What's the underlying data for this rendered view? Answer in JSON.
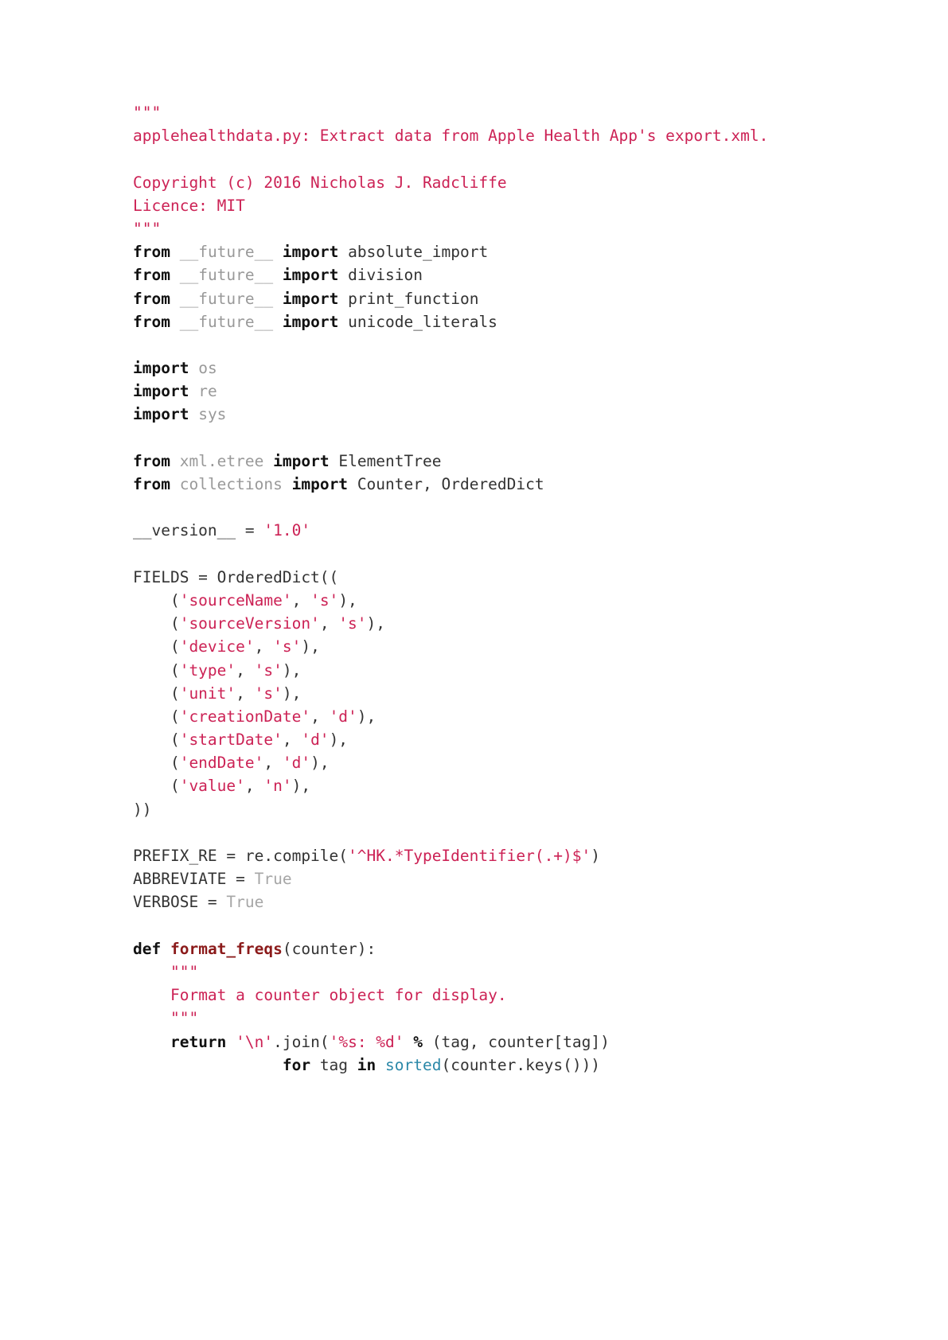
{
  "document": {
    "kind": "python-source-listing",
    "file_title": "applehealthdata.py",
    "background_color": "#ffffff",
    "token_colors": {
      "string": "#cc2255",
      "docstring": "#cc2255",
      "keyword": "#111111",
      "operator": "#111111",
      "module": "#999999",
      "constant": "#a6a6a6",
      "function_name": "#8b1a1a",
      "builtin": "#2b88a8",
      "plain": "#333333"
    }
  },
  "code": {
    "lines": [
      {
        "id": "l1",
        "text": "\"\"\"",
        "tokens": [
          {
            "t": "\"\"\"",
            "c": "tok-doc"
          }
        ]
      },
      {
        "id": "l2",
        "text": "applehealthdata.py: Extract data from Apple Health App's export.xml.",
        "tokens": [
          {
            "t": "applehealthdata.py: Extract data from Apple Health App's export.xml.",
            "c": "tok-doc"
          }
        ]
      },
      {
        "id": "l3",
        "text": "",
        "tokens": []
      },
      {
        "id": "l4",
        "text": "Copyright (c) 2016 Nicholas J. Radcliffe",
        "tokens": [
          {
            "t": "Copyright (c) 2016 Nicholas J. Radcliffe",
            "c": "tok-doc"
          }
        ]
      },
      {
        "id": "l5",
        "text": "Licence: MIT",
        "tokens": [
          {
            "t": "Licence: MIT",
            "c": "tok-doc"
          }
        ]
      },
      {
        "id": "l6",
        "text": "\"\"\"",
        "tokens": [
          {
            "t": "\"\"\"",
            "c": "tok-doc"
          }
        ]
      },
      {
        "id": "l7",
        "text": "from __future__ import absolute_import",
        "tokens": [
          {
            "t": "from",
            "c": "tok-kw"
          },
          {
            "t": " ",
            "c": "tok-plain"
          },
          {
            "t": "__future__",
            "c": "tok-mod"
          },
          {
            "t": " ",
            "c": "tok-plain"
          },
          {
            "t": "import",
            "c": "tok-kw"
          },
          {
            "t": " ",
            "c": "tok-plain"
          },
          {
            "t": "absolute_import",
            "c": "tok-name"
          }
        ]
      },
      {
        "id": "l8",
        "text": "from __future__ import division",
        "tokens": [
          {
            "t": "from",
            "c": "tok-kw"
          },
          {
            "t": " ",
            "c": "tok-plain"
          },
          {
            "t": "__future__",
            "c": "tok-mod"
          },
          {
            "t": " ",
            "c": "tok-plain"
          },
          {
            "t": "import",
            "c": "tok-kw"
          },
          {
            "t": " ",
            "c": "tok-plain"
          },
          {
            "t": "division",
            "c": "tok-name"
          }
        ]
      },
      {
        "id": "l9",
        "text": "from __future__ import print_function",
        "tokens": [
          {
            "t": "from",
            "c": "tok-kw"
          },
          {
            "t": " ",
            "c": "tok-plain"
          },
          {
            "t": "__future__",
            "c": "tok-mod"
          },
          {
            "t": " ",
            "c": "tok-plain"
          },
          {
            "t": "import",
            "c": "tok-kw"
          },
          {
            "t": " ",
            "c": "tok-plain"
          },
          {
            "t": "print_function",
            "c": "tok-name"
          }
        ]
      },
      {
        "id": "l10",
        "text": "from __future__ import unicode_literals",
        "tokens": [
          {
            "t": "from",
            "c": "tok-kw"
          },
          {
            "t": " ",
            "c": "tok-plain"
          },
          {
            "t": "__future__",
            "c": "tok-mod"
          },
          {
            "t": " ",
            "c": "tok-plain"
          },
          {
            "t": "import",
            "c": "tok-kw"
          },
          {
            "t": " ",
            "c": "tok-plain"
          },
          {
            "t": "unicode_literals",
            "c": "tok-name"
          }
        ]
      },
      {
        "id": "l11",
        "text": "",
        "tokens": []
      },
      {
        "id": "l12",
        "text": "import os",
        "tokens": [
          {
            "t": "import",
            "c": "tok-kw"
          },
          {
            "t": " ",
            "c": "tok-plain"
          },
          {
            "t": "os",
            "c": "tok-mod"
          }
        ]
      },
      {
        "id": "l13",
        "text": "import re",
        "tokens": [
          {
            "t": "import",
            "c": "tok-kw"
          },
          {
            "t": " ",
            "c": "tok-plain"
          },
          {
            "t": "re",
            "c": "tok-mod"
          }
        ]
      },
      {
        "id": "l14",
        "text": "import sys",
        "tokens": [
          {
            "t": "import",
            "c": "tok-kw"
          },
          {
            "t": " ",
            "c": "tok-plain"
          },
          {
            "t": "sys",
            "c": "tok-mod"
          }
        ]
      },
      {
        "id": "l15",
        "text": "",
        "tokens": []
      },
      {
        "id": "l16",
        "text": "from xml.etree import ElementTree",
        "tokens": [
          {
            "t": "from",
            "c": "tok-kw"
          },
          {
            "t": " ",
            "c": "tok-plain"
          },
          {
            "t": "xml.etree",
            "c": "tok-mod"
          },
          {
            "t": " ",
            "c": "tok-plain"
          },
          {
            "t": "import",
            "c": "tok-kw"
          },
          {
            "t": " ",
            "c": "tok-plain"
          },
          {
            "t": "ElementTree",
            "c": "tok-name"
          }
        ]
      },
      {
        "id": "l17",
        "text": "from collections import Counter, OrderedDict",
        "tokens": [
          {
            "t": "from",
            "c": "tok-kw"
          },
          {
            "t": " ",
            "c": "tok-plain"
          },
          {
            "t": "collections",
            "c": "tok-mod"
          },
          {
            "t": " ",
            "c": "tok-plain"
          },
          {
            "t": "import",
            "c": "tok-kw"
          },
          {
            "t": " ",
            "c": "tok-plain"
          },
          {
            "t": "Counter, OrderedDict",
            "c": "tok-name"
          }
        ]
      },
      {
        "id": "l18",
        "text": "",
        "tokens": []
      },
      {
        "id": "l19",
        "text": "__version__ = '1.0'",
        "tokens": [
          {
            "t": "__version__ = ",
            "c": "tok-plain"
          },
          {
            "t": "'1.0'",
            "c": "tok-str"
          }
        ]
      },
      {
        "id": "l20",
        "text": "",
        "tokens": []
      },
      {
        "id": "l21",
        "text": "FIELDS = OrderedDict((",
        "tokens": [
          {
            "t": "FIELDS = OrderedDict((",
            "c": "tok-plain"
          }
        ]
      },
      {
        "id": "l22",
        "text": "    ('sourceName', 's'),",
        "tokens": [
          {
            "t": "    (",
            "c": "tok-plain"
          },
          {
            "t": "'sourceName'",
            "c": "tok-str"
          },
          {
            "t": ", ",
            "c": "tok-plain"
          },
          {
            "t": "'s'",
            "c": "tok-str"
          },
          {
            "t": "),",
            "c": "tok-plain"
          }
        ]
      },
      {
        "id": "l23",
        "text": "    ('sourceVersion', 's'),",
        "tokens": [
          {
            "t": "    (",
            "c": "tok-plain"
          },
          {
            "t": "'sourceVersion'",
            "c": "tok-str"
          },
          {
            "t": ", ",
            "c": "tok-plain"
          },
          {
            "t": "'s'",
            "c": "tok-str"
          },
          {
            "t": "),",
            "c": "tok-plain"
          }
        ]
      },
      {
        "id": "l24",
        "text": "    ('device', 's'),",
        "tokens": [
          {
            "t": "    (",
            "c": "tok-plain"
          },
          {
            "t": "'device'",
            "c": "tok-str"
          },
          {
            "t": ", ",
            "c": "tok-plain"
          },
          {
            "t": "'s'",
            "c": "tok-str"
          },
          {
            "t": "),",
            "c": "tok-plain"
          }
        ]
      },
      {
        "id": "l25",
        "text": "    ('type', 's'),",
        "tokens": [
          {
            "t": "    (",
            "c": "tok-plain"
          },
          {
            "t": "'type'",
            "c": "tok-str"
          },
          {
            "t": ", ",
            "c": "tok-plain"
          },
          {
            "t": "'s'",
            "c": "tok-str"
          },
          {
            "t": "),",
            "c": "tok-plain"
          }
        ]
      },
      {
        "id": "l26",
        "text": "    ('unit', 's'),",
        "tokens": [
          {
            "t": "    (",
            "c": "tok-plain"
          },
          {
            "t": "'unit'",
            "c": "tok-str"
          },
          {
            "t": ", ",
            "c": "tok-plain"
          },
          {
            "t": "'s'",
            "c": "tok-str"
          },
          {
            "t": "),",
            "c": "tok-plain"
          }
        ]
      },
      {
        "id": "l27",
        "text": "    ('creationDate', 'd'),",
        "tokens": [
          {
            "t": "    (",
            "c": "tok-plain"
          },
          {
            "t": "'creationDate'",
            "c": "tok-str"
          },
          {
            "t": ", ",
            "c": "tok-plain"
          },
          {
            "t": "'d'",
            "c": "tok-str"
          },
          {
            "t": "),",
            "c": "tok-plain"
          }
        ]
      },
      {
        "id": "l28",
        "text": "    ('startDate', 'd'),",
        "tokens": [
          {
            "t": "    (",
            "c": "tok-plain"
          },
          {
            "t": "'startDate'",
            "c": "tok-str"
          },
          {
            "t": ", ",
            "c": "tok-plain"
          },
          {
            "t": "'d'",
            "c": "tok-str"
          },
          {
            "t": "),",
            "c": "tok-plain"
          }
        ]
      },
      {
        "id": "l29",
        "text": "    ('endDate', 'd'),",
        "tokens": [
          {
            "t": "    (",
            "c": "tok-plain"
          },
          {
            "t": "'endDate'",
            "c": "tok-str"
          },
          {
            "t": ", ",
            "c": "tok-plain"
          },
          {
            "t": "'d'",
            "c": "tok-str"
          },
          {
            "t": "),",
            "c": "tok-plain"
          }
        ]
      },
      {
        "id": "l30",
        "text": "    ('value', 'n'),",
        "tokens": [
          {
            "t": "    (",
            "c": "tok-plain"
          },
          {
            "t": "'value'",
            "c": "tok-str"
          },
          {
            "t": ", ",
            "c": "tok-plain"
          },
          {
            "t": "'n'",
            "c": "tok-str"
          },
          {
            "t": "),",
            "c": "tok-plain"
          }
        ]
      },
      {
        "id": "l31",
        "text": "))",
        "tokens": [
          {
            "t": "))",
            "c": "tok-plain"
          }
        ]
      },
      {
        "id": "l32",
        "text": "",
        "tokens": []
      },
      {
        "id": "l33",
        "text": "PREFIX_RE = re.compile('^HK.*TypeIdentifier(.+)$')",
        "tokens": [
          {
            "t": "PREFIX_RE = re.compile(",
            "c": "tok-plain"
          },
          {
            "t": "'^HK.*TypeIdentifier(.+)$'",
            "c": "tok-str"
          },
          {
            "t": ")",
            "c": "tok-plain"
          }
        ]
      },
      {
        "id": "l34",
        "text": "ABBREVIATE = True",
        "tokens": [
          {
            "t": "ABBREVIATE = ",
            "c": "tok-plain"
          },
          {
            "t": "True",
            "c": "tok-const"
          }
        ]
      },
      {
        "id": "l35",
        "text": "VERBOSE = True",
        "tokens": [
          {
            "t": "VERBOSE = ",
            "c": "tok-plain"
          },
          {
            "t": "True",
            "c": "tok-const"
          }
        ]
      },
      {
        "id": "l36",
        "text": "",
        "tokens": []
      },
      {
        "id": "l37",
        "text": "def format_freqs(counter):",
        "tokens": [
          {
            "t": "def",
            "c": "tok-kw"
          },
          {
            "t": " ",
            "c": "tok-plain"
          },
          {
            "t": "format_freqs",
            "c": "tok-func"
          },
          {
            "t": "(counter):",
            "c": "tok-plain"
          }
        ]
      },
      {
        "id": "l38",
        "text": "    \"\"\"",
        "tokens": [
          {
            "t": "    ",
            "c": "tok-plain"
          },
          {
            "t": "\"\"\"",
            "c": "tok-doc"
          }
        ]
      },
      {
        "id": "l39",
        "text": "    Format a counter object for display.",
        "tokens": [
          {
            "t": "    ",
            "c": "tok-plain"
          },
          {
            "t": "Format a counter object for display.",
            "c": "tok-doc"
          }
        ]
      },
      {
        "id": "l40",
        "text": "    \"\"\"",
        "tokens": [
          {
            "t": "    ",
            "c": "tok-plain"
          },
          {
            "t": "\"\"\"",
            "c": "tok-doc"
          }
        ]
      },
      {
        "id": "l41",
        "text": "    return '\\n'.join('%s: %d' % (tag, counter[tag])",
        "tokens": [
          {
            "t": "    ",
            "c": "tok-plain"
          },
          {
            "t": "return",
            "c": "tok-kw"
          },
          {
            "t": " ",
            "c": "tok-plain"
          },
          {
            "t": "'\\n'",
            "c": "tok-str"
          },
          {
            "t": ".join(",
            "c": "tok-plain"
          },
          {
            "t": "'%s: %d'",
            "c": "tok-str"
          },
          {
            "t": " ",
            "c": "tok-plain"
          },
          {
            "t": "%",
            "c": "tok-op"
          },
          {
            "t": " (tag, counter[tag])",
            "c": "tok-plain"
          }
        ]
      },
      {
        "id": "l42",
        "text": "                for tag in sorted(counter.keys()))",
        "tokens": [
          {
            "t": "                ",
            "c": "tok-plain"
          },
          {
            "t": "for",
            "c": "tok-kw"
          },
          {
            "t": " tag ",
            "c": "tok-plain"
          },
          {
            "t": "in",
            "c": "tok-kw"
          },
          {
            "t": " ",
            "c": "tok-plain"
          },
          {
            "t": "sorted",
            "c": "tok-builtin"
          },
          {
            "t": "(counter.keys()))",
            "c": "tok-plain"
          }
        ]
      }
    ]
  }
}
